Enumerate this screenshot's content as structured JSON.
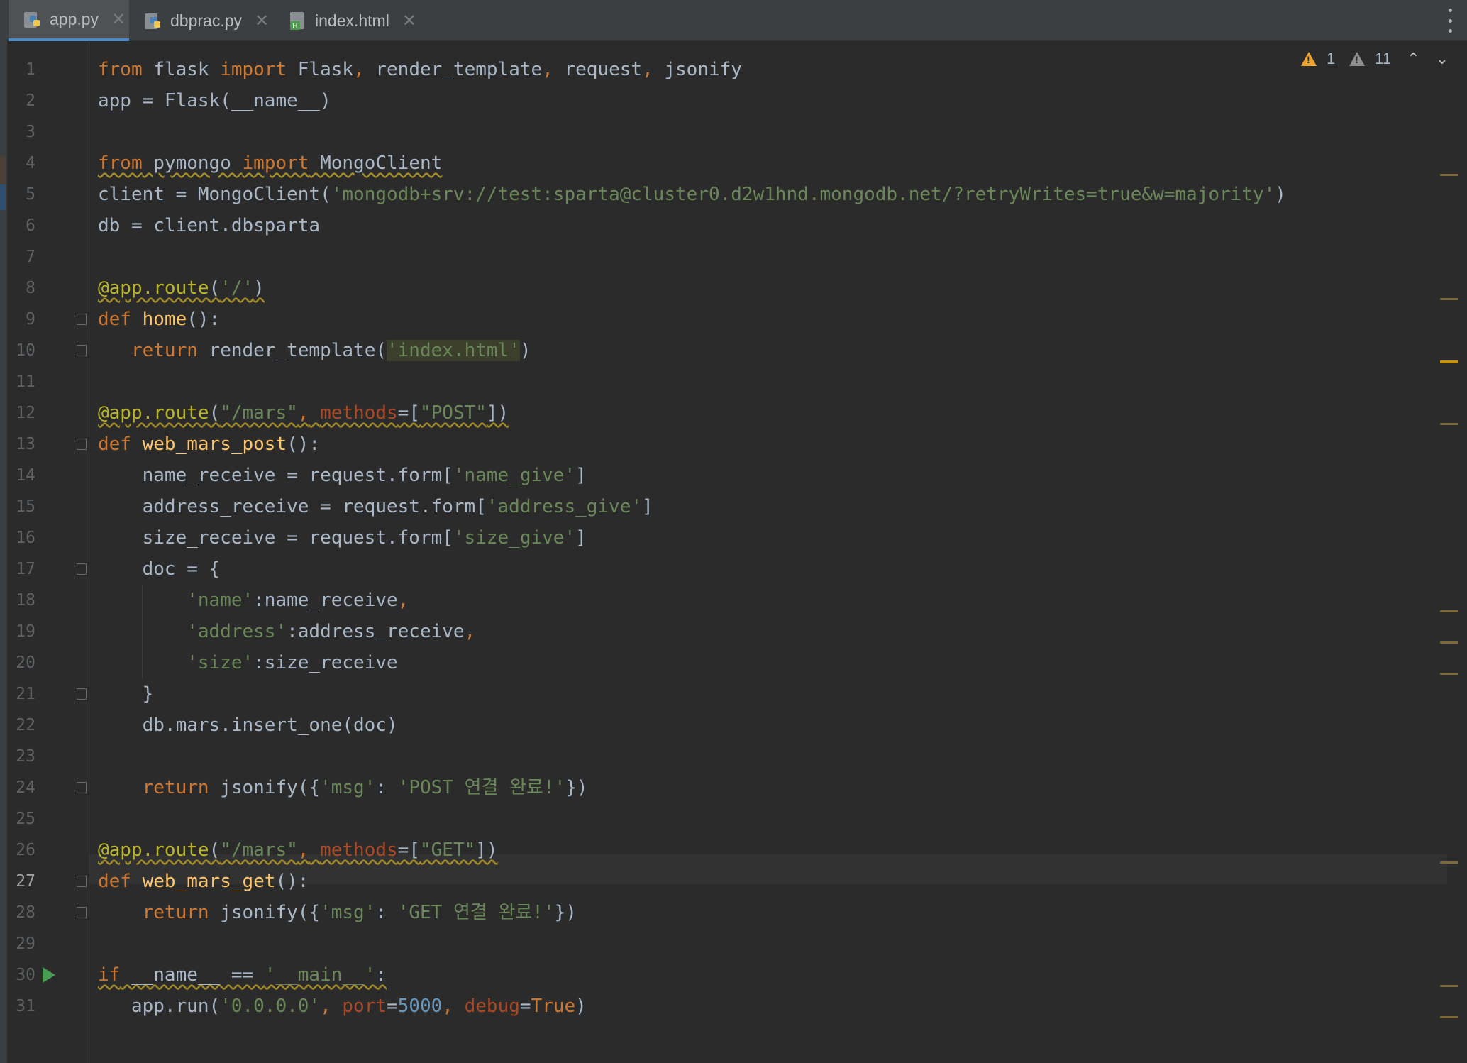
{
  "tabs": [
    {
      "label": "app.py",
      "icon": "python-file-icon",
      "active": true
    },
    {
      "label": "dbprac.py",
      "icon": "python-file-icon",
      "active": false
    },
    {
      "label": "index.html",
      "icon": "html-file-icon",
      "active": false
    }
  ],
  "inspections": {
    "errors": "1",
    "warnings": "11"
  },
  "colors": {
    "keyword": "#cc7832",
    "string": "#6a8759",
    "decorator": "#bbb529",
    "function": "#ffc66d",
    "number": "#6897bb",
    "param": "#aa4926",
    "text": "#a9b7c6"
  },
  "current_line": 27,
  "run_line": 30,
  "editor": {
    "lines": [
      [
        [
          "kw",
          "from"
        ],
        [
          "t",
          " flask "
        ],
        [
          "kw",
          "import"
        ],
        [
          "t",
          " Flask"
        ],
        [
          "kw",
          ","
        ],
        [
          "t",
          " render_template"
        ],
        [
          "kw",
          ","
        ],
        [
          "t",
          " request"
        ],
        [
          "kw",
          ","
        ],
        [
          "t",
          " jsonify"
        ]
      ],
      [
        [
          "t",
          "app = Flask(__name__)"
        ]
      ],
      [],
      [
        [
          "kw",
          "from"
        ],
        [
          "t",
          " pymongo "
        ],
        [
          "kw",
          "import"
        ],
        [
          "t",
          " MongoClient"
        ]
      ],
      [
        [
          "t",
          "client = MongoClient("
        ],
        [
          "str",
          "'mongodb+srv://test:sparta@cluster0.d2w1hnd.mongodb.net/?retryWrites=true&w=majority'"
        ],
        [
          "t",
          ")"
        ]
      ],
      [
        [
          "t",
          "db = client.dbsparta"
        ]
      ],
      [],
      [
        [
          "dec",
          "@app.route"
        ],
        [
          "t",
          "("
        ],
        [
          "str",
          "'/'"
        ],
        [
          "t",
          ")"
        ]
      ],
      [
        [
          "kw",
          "def"
        ],
        [
          "t",
          " "
        ],
        [
          "fn",
          "home"
        ],
        [
          "t",
          "():"
        ]
      ],
      [
        [
          "t",
          "   "
        ],
        [
          "kw",
          "return"
        ],
        [
          "t",
          " render_template("
        ],
        [
          "str",
          "'index.html'"
        ],
        [
          "t",
          ")"
        ]
      ],
      [],
      [
        [
          "dec",
          "@app.route"
        ],
        [
          "t",
          "("
        ],
        [
          "str",
          "\"/mars\""
        ],
        [
          "kw",
          ","
        ],
        [
          "t",
          " "
        ],
        [
          "param",
          "methods"
        ],
        [
          "t",
          "=["
        ],
        [
          "str",
          "\"POST\""
        ],
        [
          "t",
          "])"
        ]
      ],
      [
        [
          "kw",
          "def"
        ],
        [
          "t",
          " "
        ],
        [
          "fn",
          "web_mars_post"
        ],
        [
          "t",
          "():"
        ]
      ],
      [
        [
          "t",
          "    name_receive = request.form["
        ],
        [
          "str",
          "'name_give'"
        ],
        [
          "t",
          "]"
        ]
      ],
      [
        [
          "t",
          "    address_receive = request.form["
        ],
        [
          "str",
          "'address_give'"
        ],
        [
          "t",
          "]"
        ]
      ],
      [
        [
          "t",
          "    size_receive = request.form["
        ],
        [
          "str",
          "'size_give'"
        ],
        [
          "t",
          "]"
        ]
      ],
      [
        [
          "t",
          "    doc = {"
        ]
      ],
      [
        [
          "t",
          "        "
        ],
        [
          "str",
          "'name'"
        ],
        [
          "t",
          ":name_receive"
        ],
        [
          "kw",
          ","
        ]
      ],
      [
        [
          "t",
          "        "
        ],
        [
          "str",
          "'address'"
        ],
        [
          "t",
          ":address_receive"
        ],
        [
          "kw",
          ","
        ]
      ],
      [
        [
          "t",
          "        "
        ],
        [
          "str",
          "'size'"
        ],
        [
          "t",
          ":size_receive"
        ]
      ],
      [
        [
          "t",
          "    }"
        ]
      ],
      [
        [
          "t",
          "    db.mars.insert_one(doc)"
        ]
      ],
      [],
      [
        [
          "t",
          "    "
        ],
        [
          "kw",
          "return"
        ],
        [
          "t",
          " jsonify({"
        ],
        [
          "str",
          "'msg'"
        ],
        [
          "t",
          ": "
        ],
        [
          "str",
          "'POST 연결 완료!'"
        ],
        [
          "t",
          "})"
        ]
      ],
      [],
      [
        [
          "dec",
          "@app.route"
        ],
        [
          "t",
          "("
        ],
        [
          "str",
          "\"/mars\""
        ],
        [
          "kw",
          ","
        ],
        [
          "t",
          " "
        ],
        [
          "param",
          "methods"
        ],
        [
          "t",
          "=["
        ],
        [
          "str",
          "\"GET\""
        ],
        [
          "t",
          "])"
        ]
      ],
      [
        [
          "kw",
          "def"
        ],
        [
          "t",
          " "
        ],
        [
          "fn",
          "web_mars_get"
        ],
        [
          "t",
          "():"
        ]
      ],
      [
        [
          "t",
          "    "
        ],
        [
          "kw",
          "return"
        ],
        [
          "t",
          " jsonify({"
        ],
        [
          "str",
          "'msg'"
        ],
        [
          "t",
          ": "
        ],
        [
          "str",
          "'GET 연결 완료!'"
        ],
        [
          "t",
          "})"
        ]
      ],
      [],
      [
        [
          "kw",
          "if"
        ],
        [
          "t",
          " __name__ == "
        ],
        [
          "str",
          "'__main__'"
        ],
        [
          "t",
          ":"
        ]
      ],
      [
        [
          "t",
          "   app.run("
        ],
        [
          "str",
          "'0.0.0.0'"
        ],
        [
          "kw",
          ","
        ],
        [
          "t",
          " "
        ],
        [
          "param",
          "port"
        ],
        [
          "t",
          "="
        ],
        [
          "num",
          "5000"
        ],
        [
          "kw",
          ","
        ],
        [
          "t",
          " "
        ],
        [
          "param",
          "debug"
        ],
        [
          "t",
          "="
        ],
        [
          "kw",
          "True"
        ],
        [
          "t",
          ")"
        ]
      ]
    ]
  }
}
